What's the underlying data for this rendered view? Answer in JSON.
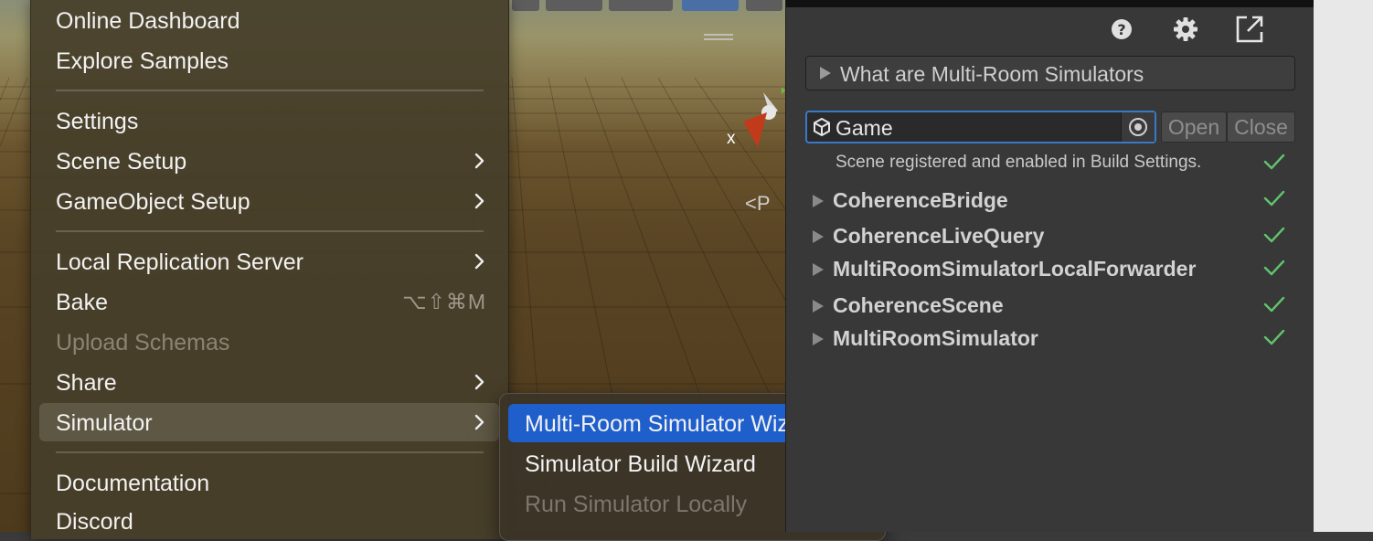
{
  "main_menu": {
    "items": [
      {
        "label": "Online Dashboard"
      },
      {
        "label": "Explore Samples"
      },
      {
        "label": "Settings"
      },
      {
        "label": "Scene Setup"
      },
      {
        "label": "GameObject Setup"
      },
      {
        "label": "Local Replication Server"
      },
      {
        "label": "Bake",
        "shortcut": "⌥⇧⌘M"
      },
      {
        "label": "Upload Schemas"
      },
      {
        "label": "Share"
      },
      {
        "label": "Simulator"
      },
      {
        "label": "Documentation"
      },
      {
        "label": "Discord"
      }
    ]
  },
  "sub_menu": {
    "items": [
      {
        "label": "Multi-Room Simulator Wizard"
      },
      {
        "label": "Simulator Build Wizard"
      },
      {
        "label": "Run Simulator Locally"
      }
    ]
  },
  "scene_view": {
    "axis_label": "x",
    "persp_label": "<P"
  },
  "panel": {
    "foldout_label": "What are Multi-Room Simulators",
    "scene_field": {
      "value": "Game"
    },
    "open_label": "Open",
    "close_label": "Close",
    "scene_status": "Scene registered and enabled in Build Settings.",
    "components": [
      {
        "name": "CoherenceBridge"
      },
      {
        "name": "CoherenceLiveQuery"
      },
      {
        "name": "MultiRoomSimulatorLocalForwarder"
      },
      {
        "name": "CoherenceScene"
      },
      {
        "name": "MultiRoomSimulator"
      }
    ]
  },
  "colors": {
    "selection": "#1f5fcc",
    "check": "#62c46e",
    "field_focus": "#3a79c9"
  }
}
